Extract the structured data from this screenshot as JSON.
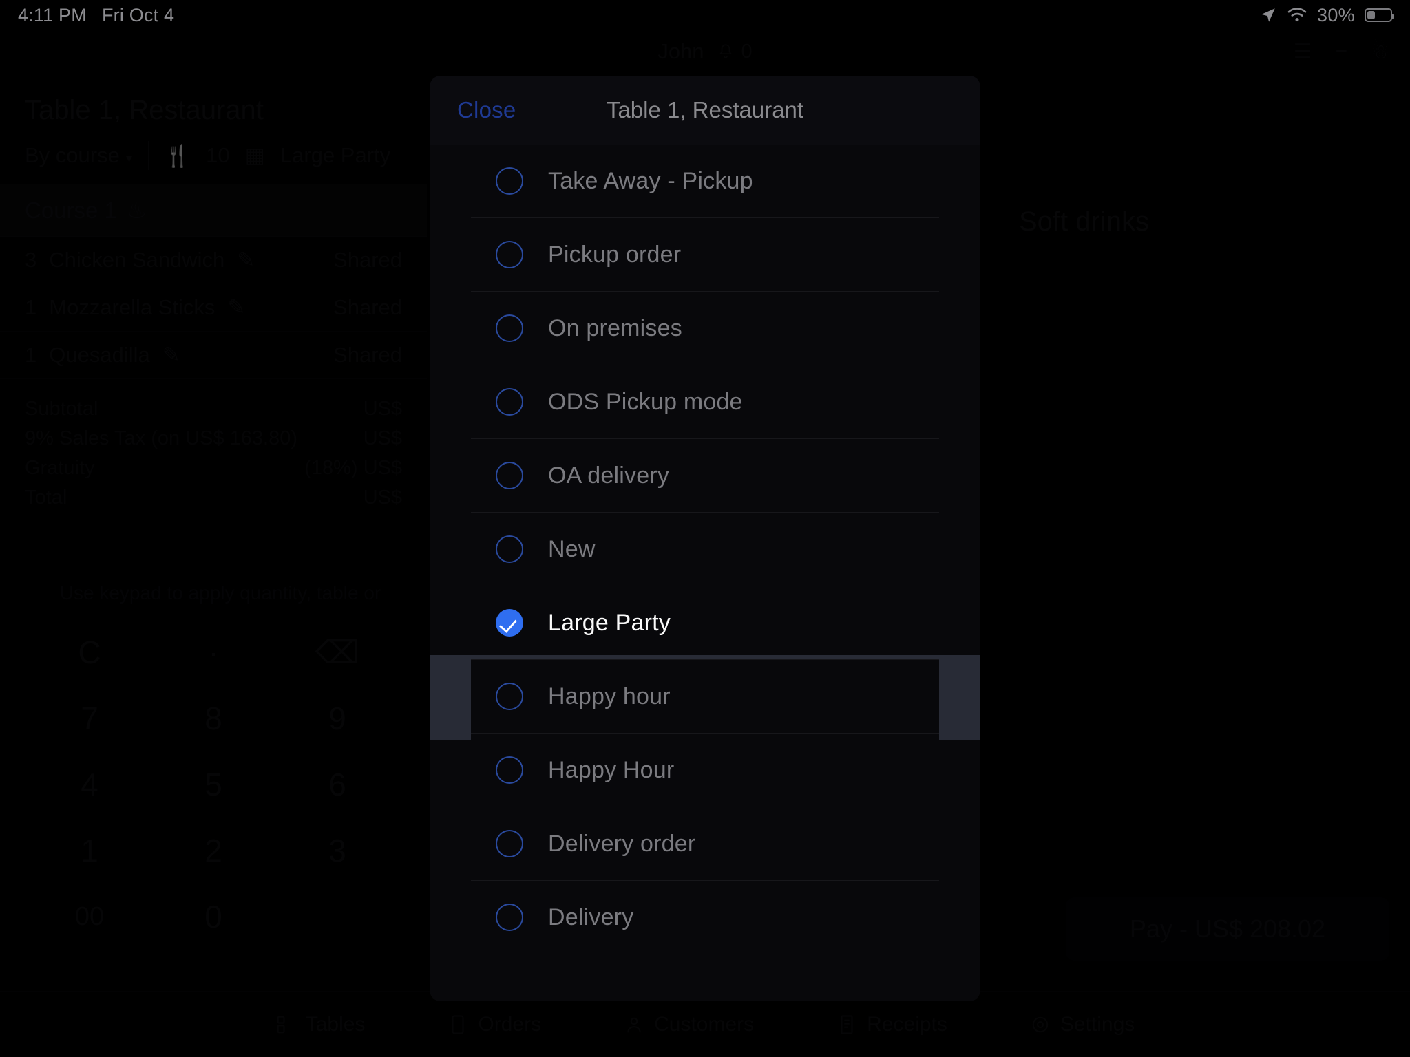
{
  "status_bar": {
    "time": "4:11 PM",
    "date": "Fri Oct 4",
    "battery_percent": "30%",
    "location_icon": "location-arrow-icon",
    "wifi_icon": "wifi-icon",
    "battery_icon": "battery-icon"
  },
  "background": {
    "topbar": {
      "user": "John",
      "bell_icon": "bell-icon",
      "notification_count": "0"
    },
    "order_panel": {
      "title": "Table 1, Restaurant",
      "sort_label": "By course",
      "guests_icon": "cutlery-icon",
      "guests": "10",
      "tag_icon": "tag-icon",
      "tag_label": "Large Party",
      "course_header": "Course 1",
      "fire_icon": "fire-icon",
      "items": [
        {
          "qty": "3",
          "name": "Chicken Sandwich",
          "edit_icon": "pencil-icon",
          "status": "Shared"
        },
        {
          "qty": "1",
          "name": "Mozzarella Sticks",
          "edit_icon": "pencil-icon",
          "status": "Shared"
        },
        {
          "qty": "1",
          "name": "Quesadilla",
          "edit_icon": "pencil-icon",
          "status": "Shared"
        }
      ],
      "totals": [
        {
          "label": "Subtotal",
          "value": "US$"
        },
        {
          "label": "9% Sales Tax (on US$ 163.80)",
          "value": "US$"
        },
        {
          "label": "Gratuity",
          "value": "(18%) US$"
        },
        {
          "label": "Total",
          "value": "US$"
        }
      ]
    },
    "keypad": {
      "hint": "Use keypad to apply quantity, table or",
      "keys": [
        [
          "C",
          "·",
          "⌫"
        ],
        [
          "7",
          "8",
          "9"
        ],
        [
          "4",
          "5",
          "6"
        ],
        [
          "1",
          "2",
          "3"
        ],
        [
          "00",
          "0",
          ""
        ]
      ]
    },
    "right_panel": {
      "title": "Soft drinks"
    },
    "pay_button": "Pay - US$ 208.02",
    "tabbar": [
      {
        "label": "Tables",
        "icon": "tables-icon"
      },
      {
        "label": "Orders",
        "icon": "orders-icon"
      },
      {
        "label": "Customers",
        "icon": "customers-icon"
      },
      {
        "label": "Receipts",
        "icon": "receipts-icon"
      },
      {
        "label": "Settings",
        "icon": "gear-icon"
      }
    ]
  },
  "modal": {
    "close_label": "Close",
    "title": "Table 1, Restaurant",
    "options": [
      {
        "label": "Take Away - Pickup",
        "selected": false
      },
      {
        "label": "Pickup order",
        "selected": false
      },
      {
        "label": "On premises",
        "selected": false
      },
      {
        "label": "ODS Pickup mode",
        "selected": false
      },
      {
        "label": "OA delivery",
        "selected": false
      },
      {
        "label": "New",
        "selected": false
      },
      {
        "label": "Large Party",
        "selected": true
      },
      {
        "label": "Happy hour",
        "selected": false
      },
      {
        "label": "Happy Hour",
        "selected": false
      },
      {
        "label": "Delivery order",
        "selected": false
      },
      {
        "label": "Delivery",
        "selected": false
      }
    ]
  },
  "colors": {
    "accent_blue": "#2f6ef0",
    "link_blue": "#1f3a93",
    "modal_bg": "#08080b",
    "selected_row_bg": "#282b36"
  }
}
